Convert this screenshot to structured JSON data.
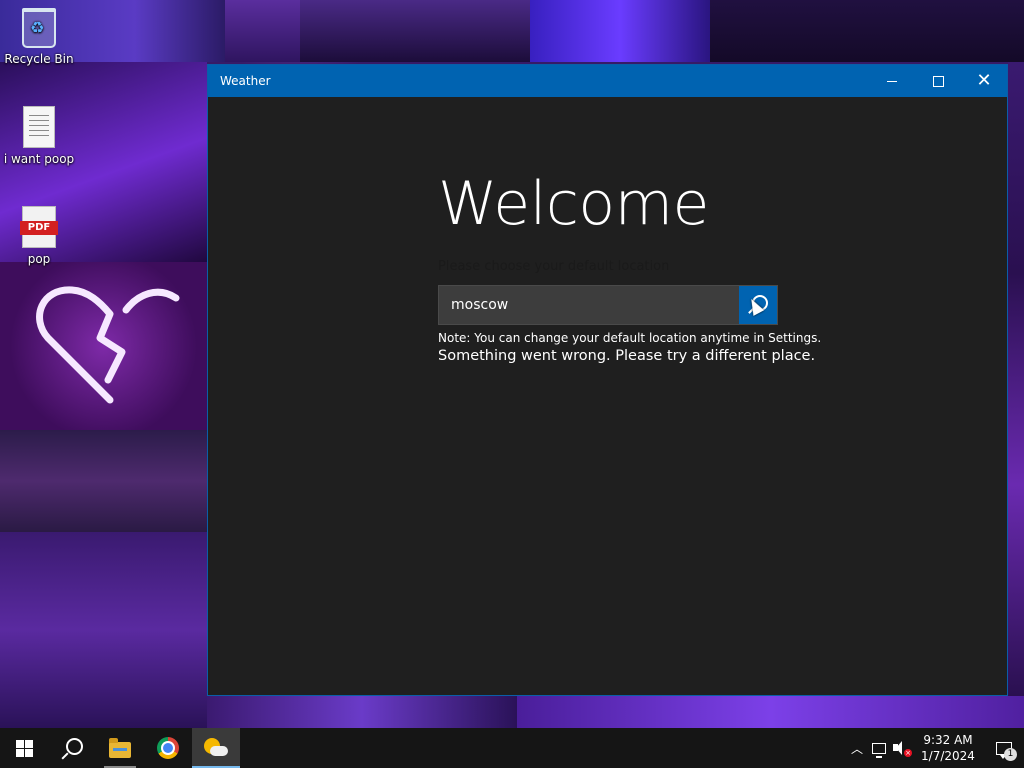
{
  "desktop": {
    "icons": [
      {
        "label": "Recycle Bin",
        "icon": "recycle-bin-icon"
      },
      {
        "label": "i want poop",
        "icon": "text-file-icon"
      },
      {
        "label": "pop",
        "icon": "pdf-file-icon"
      }
    ]
  },
  "window": {
    "title": "Weather",
    "controls": {
      "minimize": "minimize-icon",
      "maximize": "maximize-icon",
      "close": "close-icon"
    }
  },
  "welcome": {
    "heading": "Welcome",
    "prompt": "Please choose your default location",
    "search_value": "moscow",
    "note": "Note: You can change your default location anytime in Settings.",
    "error": "Something went wrong. Please try a different place."
  },
  "taskbar": {
    "apps": [
      {
        "name": "Start",
        "icon": "windows-icon"
      },
      {
        "name": "Search",
        "icon": "search-icon"
      },
      {
        "name": "File Explorer",
        "icon": "folder-icon"
      },
      {
        "name": "Google Chrome",
        "icon": "chrome-icon"
      },
      {
        "name": "Weather",
        "icon": "weather-icon"
      }
    ],
    "tray": {
      "time": "9:32 AM",
      "date": "1/7/2024",
      "notification_count": "1"
    }
  },
  "colors": {
    "accent": "#0063b1",
    "window_bg": "#1f1f1f",
    "taskbar_bg": "#151515"
  }
}
